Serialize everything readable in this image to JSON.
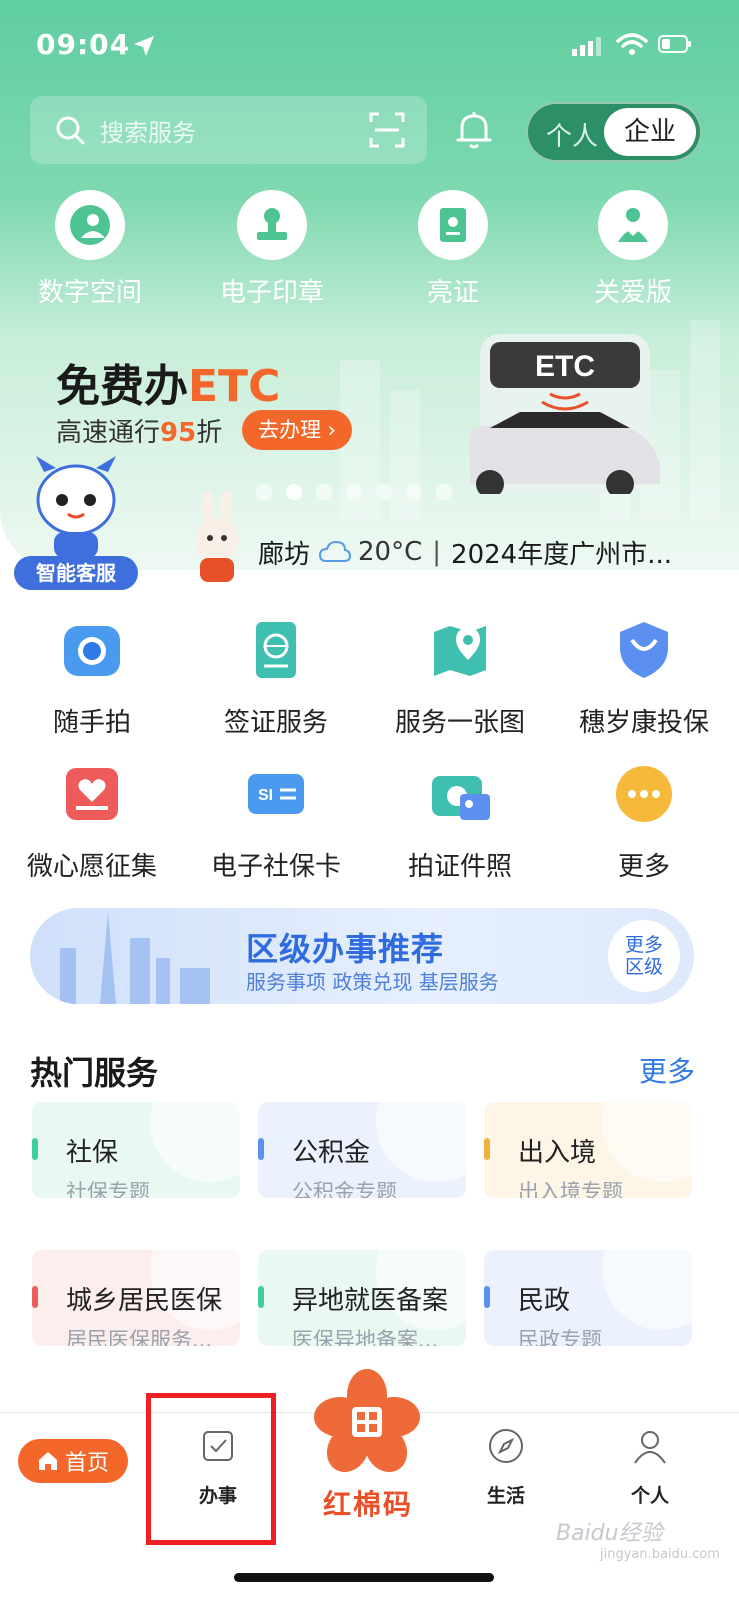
{
  "status_bar": {
    "time": "09:04"
  },
  "search": {
    "placeholder": "搜索服务"
  },
  "role_toggle": {
    "personal": "个人",
    "enterprise": "企业",
    "selected": "企业"
  },
  "quick_actions": [
    {
      "label": "数字空间",
      "icon": "digital-space-icon"
    },
    {
      "label": "电子印章",
      "icon": "stamp-icon"
    },
    {
      "label": "亮证",
      "icon": "certificate-icon"
    },
    {
      "label": "关爱版",
      "icon": "care-icon"
    }
  ],
  "banner": {
    "title_prefix": "免费办",
    "title_highlight": "ETC",
    "subtitle_prefix": "高速通行",
    "subtitle_highlight": "95",
    "subtitle_suffix": "折",
    "button": "去办理",
    "gate_text": "ETC",
    "page_count": 7,
    "active_page": 2
  },
  "assistant": {
    "label": "智能客服"
  },
  "weather": {
    "city": "廊坊",
    "temperature": "20°C",
    "news": "2024年度广州市..."
  },
  "services": [
    {
      "label": "随手拍",
      "icon": "camera-icon"
    },
    {
      "label": "签证服务",
      "icon": "passport-icon"
    },
    {
      "label": "服务一张图",
      "icon": "map-icon"
    },
    {
      "label": "穗岁康投保",
      "icon": "shield-icon"
    },
    {
      "label": "微心愿征集",
      "icon": "wish-icon"
    },
    {
      "label": "电子社保卡",
      "icon": "social-card-icon"
    },
    {
      "label": "拍证件照",
      "icon": "id-photo-icon"
    },
    {
      "label": "更多",
      "icon": "more-icon"
    }
  ],
  "district": {
    "title": "区级办事推荐",
    "subtitle": "服务事项 政策兑现 基层服务",
    "more_line1": "更多",
    "more_line2": "区级"
  },
  "hot_services": {
    "title": "热门服务",
    "more": "更多",
    "cards": [
      {
        "title": "社保",
        "subtitle": "社保专题",
        "accent": "#3fcf9c",
        "bg": "#eaf8f2"
      },
      {
        "title": "公积金",
        "subtitle": "公积金专题",
        "accent": "#5b8ff0",
        "bg": "#ecf2fd"
      },
      {
        "title": "出入境",
        "subtitle": "出入境专题",
        "accent": "#f0b23c",
        "bg": "#fdf5e6"
      },
      {
        "title": "城乡居民医保",
        "subtitle": "居民医保服务...",
        "accent": "#ee5d5d",
        "bg": "#fdeeee"
      },
      {
        "title": "异地就医备案",
        "subtitle": "医保异地备案...",
        "accent": "#3fcf9c",
        "bg": "#eaf8f2"
      },
      {
        "title": "民政",
        "subtitle": "民政专题",
        "accent": "#5b8ff0",
        "bg": "#ecf2fd"
      }
    ]
  },
  "tabbar": {
    "home": "首页",
    "affairs": "办事",
    "center": "红棉码",
    "life": "生活",
    "personal": "个人"
  },
  "watermark": {
    "main": "Baidu经验",
    "sub": "jingyan.baidu.com"
  },
  "colors": {
    "brand_green": "#5fcea0",
    "accent_orange": "#f4672a",
    "link_blue": "#2f7be6",
    "highlight_red": "#f01f24"
  }
}
